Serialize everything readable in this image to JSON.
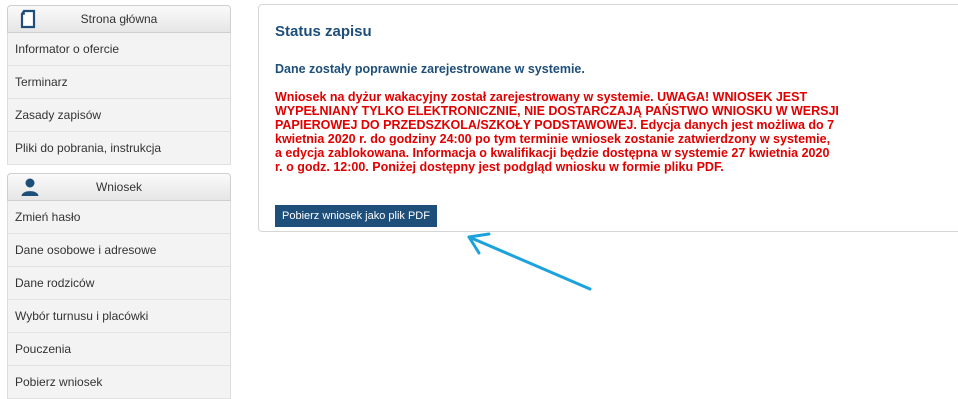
{
  "sidebar": {
    "section1": {
      "title": "Strona główna",
      "icon": "document-icon",
      "items": [
        {
          "label": "Informator o ofercie"
        },
        {
          "label": "Terminarz"
        },
        {
          "label": "Zasady zapisów"
        },
        {
          "label": "Pliki do pobrania, instrukcja"
        }
      ]
    },
    "section2": {
      "title": "Wniosek",
      "icon": "user-icon",
      "items": [
        {
          "label": "Zmień hasło"
        },
        {
          "label": "Dane osobowe i adresowe"
        },
        {
          "label": "Dane rodziców"
        },
        {
          "label": "Wybór turnusu i placówki"
        },
        {
          "label": "Pouczenia"
        },
        {
          "label": "Pobierz wniosek"
        }
      ]
    }
  },
  "main": {
    "title": "Status zapisu",
    "success_message": "Dane zostały poprawnie zarejestrowane w systemie.",
    "warning_lines": [
      "Wniosek na dyżur wakacyjny został zarejestrowany w systemie. UWAGA! WNIOSEK JEST",
      "WYPEŁNIANY TYLKO ELEKTRONICZNIE, NIE DOSTARCZAJĄ PAŃSTWO WNIOSKU W WERSJI",
      "PAPIEROWEJ DO PRZEDSZKOLA/SZKOŁY PODSTAWOWEJ. Edycja danych jest możliwa do 7",
      "kwietnia 2020 r. do godziny 24:00 po tym terminie wniosek zostanie zatwierdzony w systemie,",
      "a edycja zablokowana. Informacja o kwalifikacji będzie dostępna w systemie 27 kwietnia 2020",
      "r. o godz. 12:00. Poniżej dostępny jest podgląd wniosku w formie pliku PDF."
    ],
    "download_button": "Pobierz wniosek jako plik PDF"
  },
  "colors": {
    "heading": "#1e4f7a",
    "warning": "#e00000",
    "button_bg": "#1e4f7a",
    "annotation_arrow": "#1ca3dc"
  }
}
